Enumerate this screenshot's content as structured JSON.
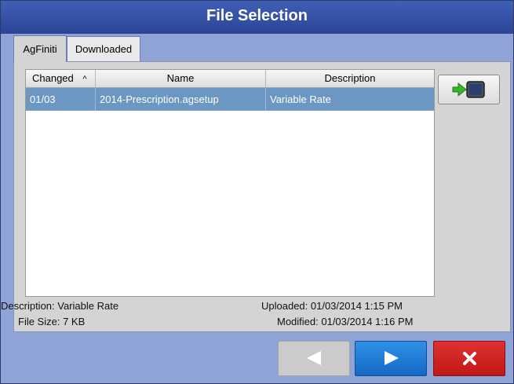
{
  "window": {
    "title": "File Selection"
  },
  "tabs": [
    {
      "label": "AgFiniti",
      "active": true
    },
    {
      "label": "Downloaded",
      "active": false
    }
  ],
  "table": {
    "columns": [
      "Changed",
      "Name",
      "Description"
    ],
    "sort_indicator": "^",
    "rows": [
      {
        "changed": "01/03",
        "name": "2014-Prescription.agsetup",
        "description": "Variable Rate",
        "selected": true
      }
    ]
  },
  "details": {
    "description": "Description: Variable Rate",
    "file_size": "File Size: 7 KB",
    "uploaded": "Uploaded: 01/03/2014 1:15 PM",
    "modified": "Modified: 01/03/2014 1:16 PM"
  },
  "buttons": {
    "import_icon": "import-arrow-icon",
    "prev_icon": "arrow-left-icon",
    "next_icon": "arrow-right-icon",
    "cancel_icon": "close-x-icon",
    "prev_enabled": false
  },
  "colors": {
    "title_bar": "#2c4596",
    "selected_row": "#6b97c2",
    "next_button": "#1a73d1",
    "cancel_button": "#cc1f1f",
    "disabled_button": "#cbcbcb"
  }
}
